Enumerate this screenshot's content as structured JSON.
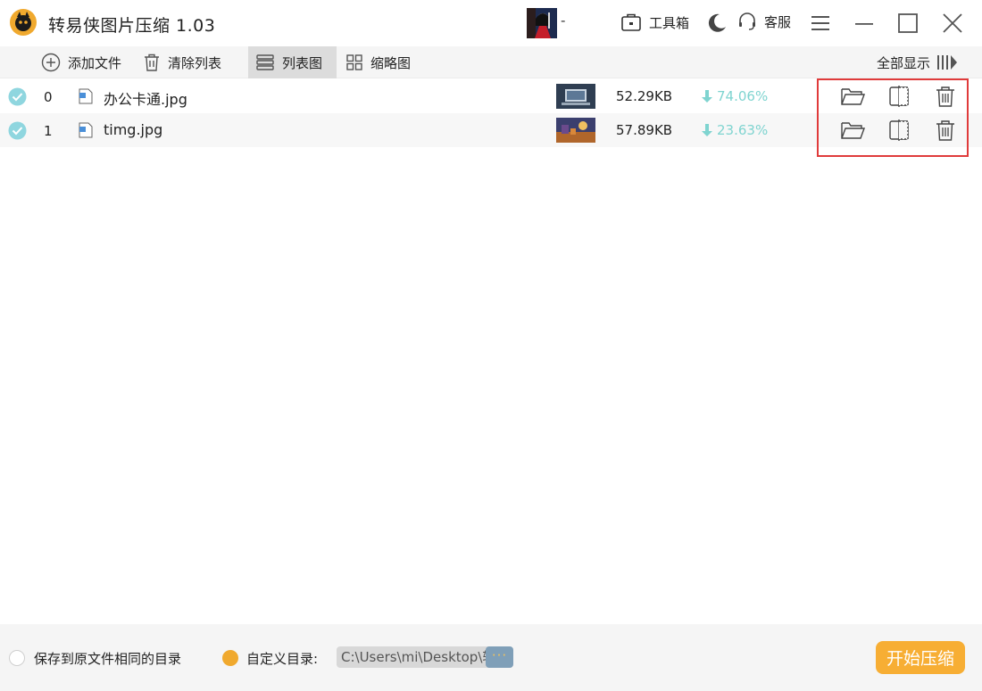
{
  "app": {
    "title": "转易侠图片压缩 1.03",
    "user_name": "-",
    "toolbox_label": "工具箱",
    "service_label": "客服"
  },
  "toolbar": {
    "add_label": "添加文件",
    "clear_label": "清除列表",
    "list_view_label": "列表图",
    "thumb_view_label": "缩略图",
    "show_all_label": "全部显示"
  },
  "files": [
    {
      "index": "0",
      "name": "办公卡通.jpg",
      "size": "52.29KB",
      "ratio": "74.06%"
    },
    {
      "index": "1",
      "name": "timg.jpg",
      "size": "57.89KB",
      "ratio": "23.63%"
    }
  ],
  "bottom": {
    "save_same_label": "保存到原文件相同的目录",
    "custom_dir_label": "自定义目录:",
    "custom_path": "C:\\Users\\mi\\Desktop\\转",
    "more_label": "···",
    "start_label": "开始压缩"
  },
  "colors": {
    "accent": "#f7ae34",
    "ratio": "#7fd4d0",
    "check": "#8fd6df",
    "highlight": "#e03b3b"
  }
}
